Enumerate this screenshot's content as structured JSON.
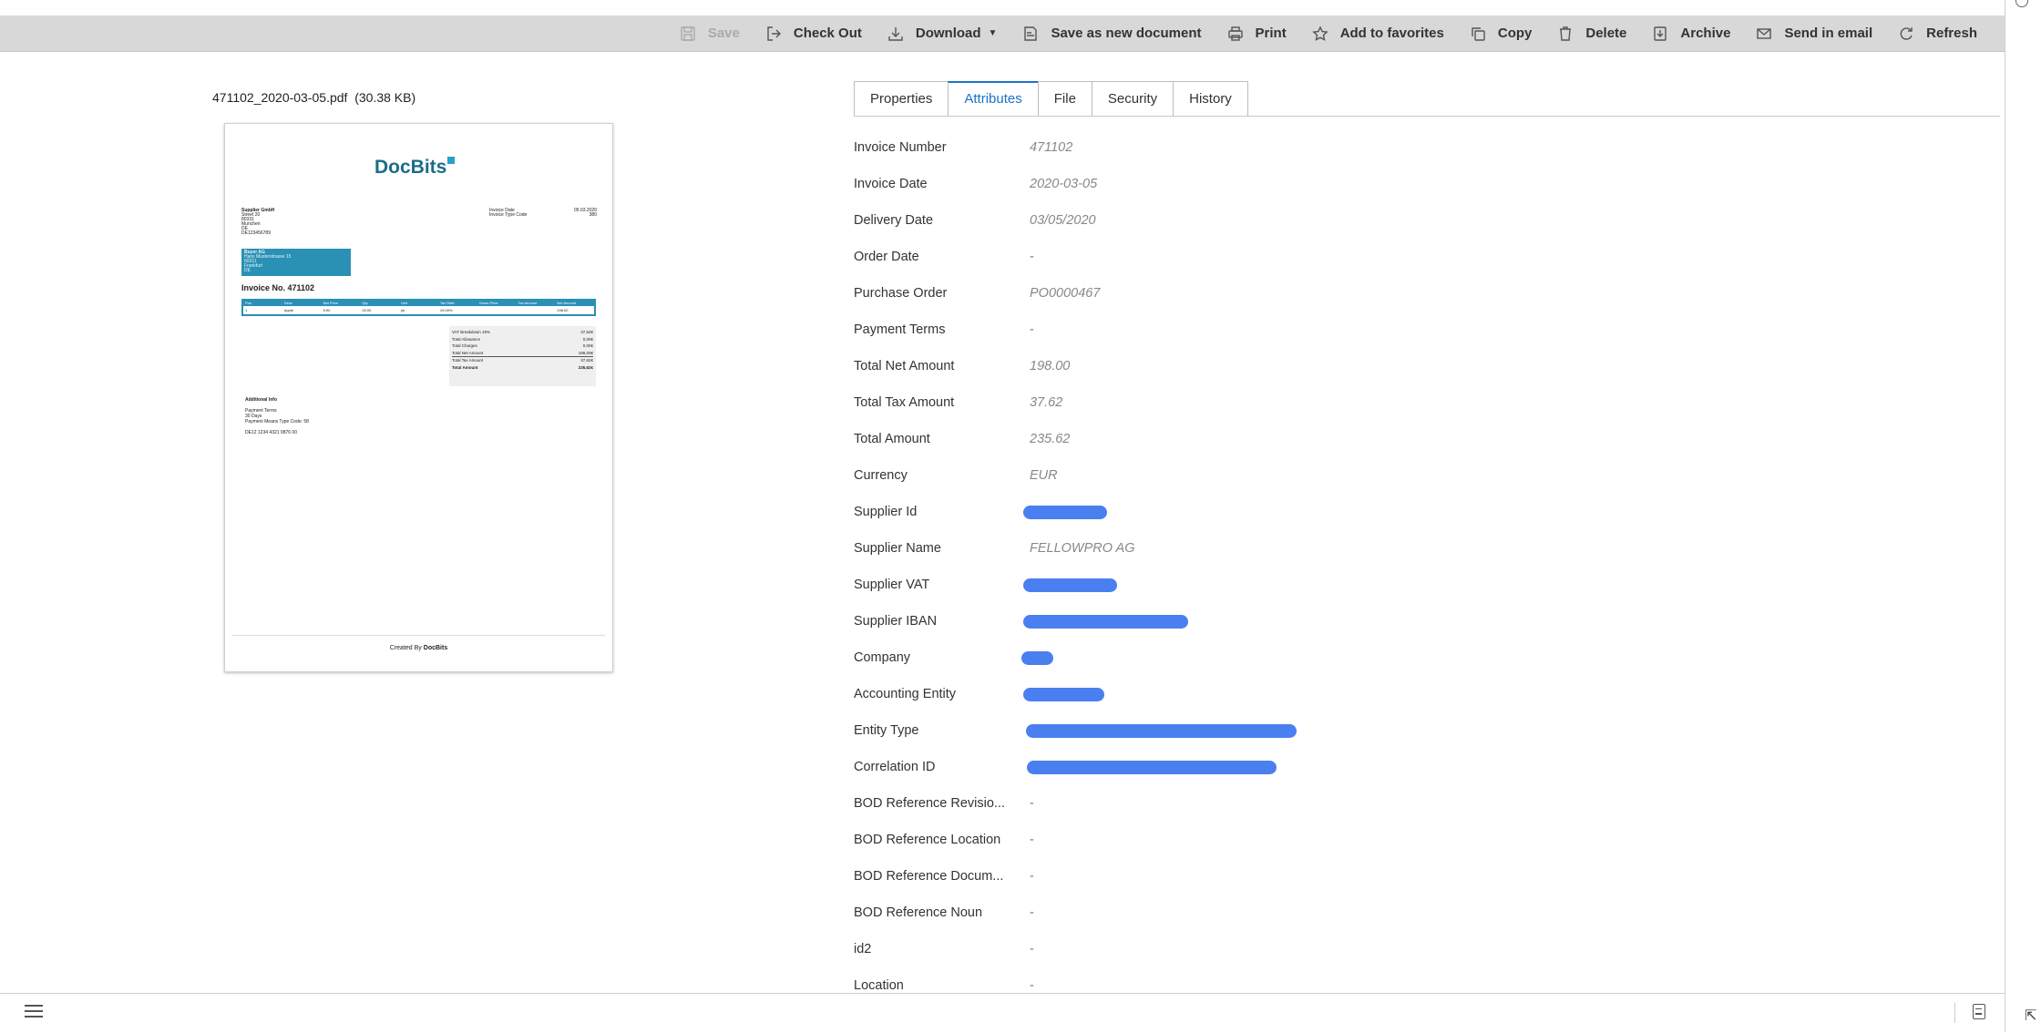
{
  "toolbar": {
    "save": "Save",
    "check_out": "Check Out",
    "download": "Download",
    "save_as_new": "Save as new document",
    "print": "Print",
    "add_to_favorites": "Add to favorites",
    "copy": "Copy",
    "delete": "Delete",
    "archive": "Archive",
    "send_in_email": "Send in email",
    "refresh": "Refresh"
  },
  "preview": {
    "file_name": "471102_2020-03-05.pdf",
    "file_size": "(30.38 KB)",
    "logo": "DocBits",
    "supplier_lines": [
      "Supplier GmbH",
      "Street 20",
      "80331",
      "Munchen",
      "DE",
      "DE123456789"
    ],
    "meta": [
      {
        "label": "Invoice Date",
        "value": "05.03.2020"
      },
      {
        "label": "Invoice Type Code",
        "value": "380"
      }
    ],
    "buyer_lines": [
      "Buyer AG",
      "Hans Musterstrasse 15",
      "60311",
      "Frankfurt",
      "DE"
    ],
    "invoice_title": "Invoice No. 471102",
    "table_headers": [
      "Pos",
      "Desc",
      "Net Price",
      "Qty",
      "Unit",
      "Tax Rate",
      "Gross Price",
      "Tax Amount",
      "Net Amount"
    ],
    "table_row": [
      "1",
      "Apple",
      "9.90",
      "20.00",
      "pk",
      "19.00%",
      "",
      "",
      "198.00"
    ],
    "totals": [
      {
        "label": "VAT Breakdown 19%",
        "value": "37,62€"
      },
      {
        "label": "Total Allowance",
        "value": "0,00€"
      },
      {
        "label": "Total Charges",
        "value": "0,00€"
      },
      {
        "label": "Total Net Amount",
        "value": "198,00€"
      },
      {
        "label": "Total Tax Amount",
        "value": "37,62€"
      },
      {
        "label": "Total Amount",
        "value": "235,62€"
      }
    ],
    "additional_title": "Additional Info",
    "additional_lines": [
      "Payment Terms",
      "30 Days",
      "Payment Means Type Code: 58",
      "",
      "DE12 1234 4321 9876 00"
    ],
    "footer_prefix": "Created By",
    "footer_brand": "DocBits"
  },
  "tabs": [
    "Properties",
    "Attributes",
    "File",
    "Security",
    "History"
  ],
  "active_tab": "Attributes",
  "attributes": [
    {
      "label": "Invoice Number",
      "value": "471102"
    },
    {
      "label": "Invoice Date",
      "value": "2020-03-05"
    },
    {
      "label": "Delivery Date",
      "value": "03/05/2020"
    },
    {
      "label": "Order Date",
      "value": "-"
    },
    {
      "label": "Purchase Order",
      "value": "PO0000467"
    },
    {
      "label": "Payment Terms",
      "value": "-"
    },
    {
      "label": "Total Net Amount",
      "value": "198.00"
    },
    {
      "label": "Total Tax Amount",
      "value": "37.62"
    },
    {
      "label": "Total Amount",
      "value": "235.62"
    },
    {
      "label": "Currency",
      "value": "EUR"
    },
    {
      "label": "Supplier Id",
      "value": null
    },
    {
      "label": "Supplier Name",
      "value": "FELLOWPRO AG"
    },
    {
      "label": "Supplier VAT",
      "value": null
    },
    {
      "label": "Supplier IBAN",
      "value": null
    },
    {
      "label": "Company",
      "value": null
    },
    {
      "label": "Accounting Entity",
      "value": null
    },
    {
      "label": "Entity Type",
      "value": null
    },
    {
      "label": "Correlation ID",
      "value": null
    },
    {
      "label": "BOD Reference Revisio...",
      "value": "-"
    },
    {
      "label": "BOD Reference Location",
      "value": "-"
    },
    {
      "label": "BOD Reference Docum...",
      "value": "-"
    },
    {
      "label": "BOD Reference Noun",
      "value": "-"
    },
    {
      "label": "id2",
      "value": "-"
    },
    {
      "label": "Location",
      "value": "-"
    }
  ],
  "colors": {
    "accent": "#1a73c8",
    "redaction": "#4a7ff0",
    "toolbar_bg": "#d8d8d8",
    "buyer_box": "#2a90b4"
  },
  "icons": {
    "save": "floppy-icon",
    "check_out": "sign-out-icon",
    "download": "download-icon",
    "save_as_new": "pdf-icon",
    "print": "printer-icon",
    "favorites": "star-icon",
    "copy": "copy-icon",
    "delete": "trash-icon",
    "archive": "archive-icon",
    "email": "envelope-icon",
    "refresh": "refresh-icon"
  }
}
